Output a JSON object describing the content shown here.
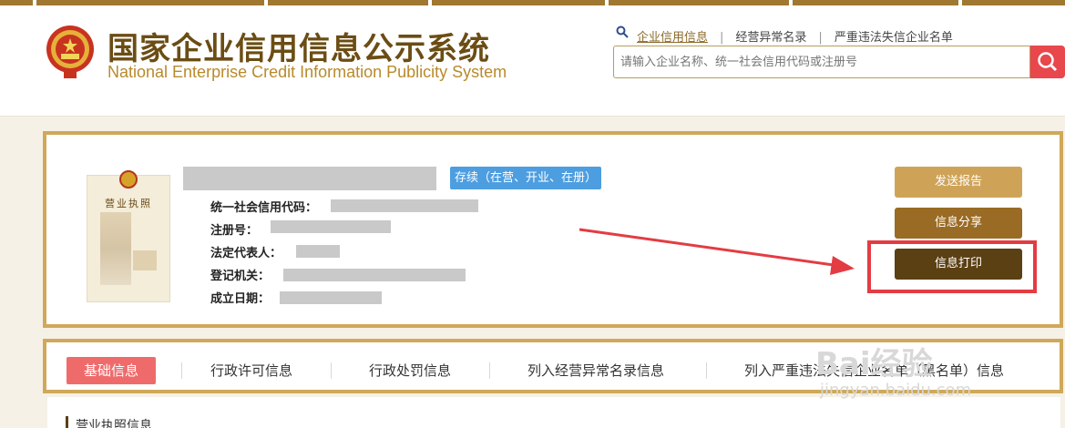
{
  "header": {
    "title_cn": "国家企业信用信息公示系统",
    "title_en": "National Enterprise Credit Information Publicity System",
    "nav": [
      "企业信用信息",
      "经营异常名录",
      "严重违法失信企业名单"
    ],
    "nav_separator": "|",
    "search_placeholder": "请输入企业名称、统一社会信用代码或注册号"
  },
  "company": {
    "status": "存续（在营、开业、在册）",
    "fields": {
      "credit_code": "统一社会信用代码：",
      "reg_no": "注册号：",
      "legal_rep": "法定代表人：",
      "authority": "登记机关：",
      "established": "成立日期："
    },
    "license_title": "营业执照"
  },
  "actions": {
    "send_report": "发送报告",
    "share": "信息分享",
    "print": "信息打印"
  },
  "tabs": [
    "基础信息",
    "行政许可信息",
    "行政处罚信息",
    "列入经营异常名录信息",
    "列入严重违法失信企业名单（黑名单）信息"
  ],
  "section": {
    "label": "营业执照信息"
  },
  "watermark": {
    "text": "Bai经验",
    "sub": "jingyan.baidu.com"
  },
  "colors": {
    "brand_gold": "#cfa959",
    "brand_brown": "#6b4d14",
    "status_blue": "#4d9ee0",
    "active_tab": "#ef6b6b",
    "annotation_red": "#e33c43"
  }
}
